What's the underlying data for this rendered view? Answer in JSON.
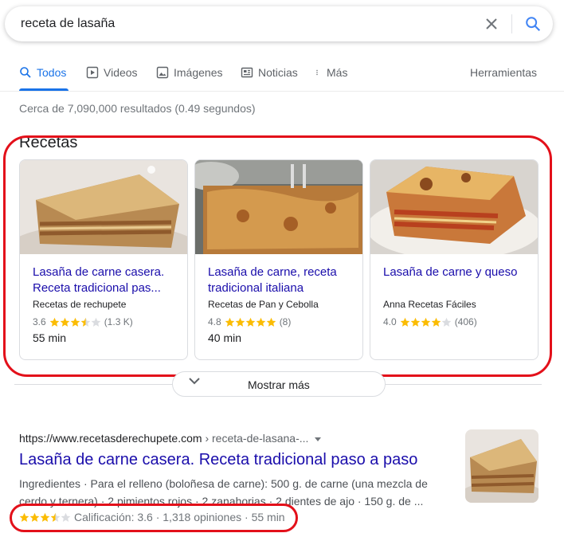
{
  "search": {
    "query": "receta de lasaña"
  },
  "tabs": [
    {
      "label": "Todos",
      "icon": "search-icon"
    },
    {
      "label": "Videos",
      "icon": "play-icon"
    },
    {
      "label": "Imágenes",
      "icon": "image-icon"
    },
    {
      "label": "Noticias",
      "icon": "news-icon"
    },
    {
      "label": "Más",
      "icon": "more-vert-icon"
    }
  ],
  "tools_label": "Herramientas",
  "stats": "Cerca de 7,090,000 resultados (0.49 segundos)",
  "recipes": {
    "title": "Recetas",
    "cards": [
      {
        "title": "Lasaña de carne casera. Receta tradicional pas...",
        "source": "Recetas de rechupete",
        "rating": "3.6",
        "stars": 3.5,
        "reviews": "(1.3 K)",
        "time": "55 min"
      },
      {
        "title": "Lasaña de carne, receta tradicional italiana",
        "source": "Recetas de Pan y Cebolla",
        "rating": "4.8",
        "stars": 5,
        "reviews": "(8)",
        "time": "40 min"
      },
      {
        "title": "Lasaña de carne y queso",
        "source": "Anna Recetas Fáciles",
        "rating": "4.0",
        "stars": 4,
        "reviews": "(406)",
        "time": ""
      }
    ],
    "more_label": "Mostrar más"
  },
  "result": {
    "url": "https://www.recetasderechupete.com",
    "crumb": " › receta-de-lasana-...",
    "title": "Lasaña de carne casera. Receta tradicional paso a paso",
    "snippet": "Ingredientes · Para el relleno (boloñesa de carne): 500 g. de carne (una mezcla de cerdo y ternera) · 2 pimientos rojos · 2 zanahorias · 2 dientes de ajo · 150 g. de ...",
    "stars": 3.5,
    "rating_text": "Calificación: 3.6 · 1,318 opiniones · 55 min"
  },
  "colors": {
    "accent": "#1a73e8",
    "link": "#1a0dab",
    "star": "#fbbc04",
    "highlight": "#e3101a"
  }
}
